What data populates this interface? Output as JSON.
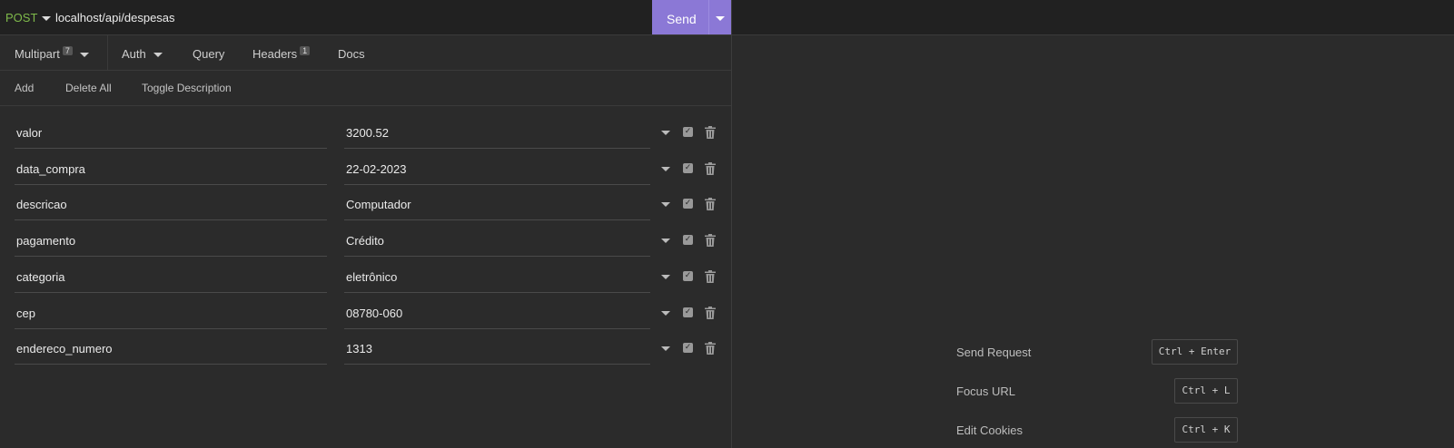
{
  "request": {
    "method": "POST",
    "url": "localhost/api/despesas",
    "send_label": "Send"
  },
  "tabs": [
    {
      "label": "Multipart",
      "badge": "7"
    },
    {
      "label": "Auth"
    },
    {
      "label": "Query"
    },
    {
      "label": "Headers",
      "badge": "1"
    },
    {
      "label": "Docs"
    }
  ],
  "actions": {
    "add": "Add",
    "delete_all": "Delete All",
    "toggle_description": "Toggle Description"
  },
  "params": [
    {
      "name": "valor",
      "value": "3200.52"
    },
    {
      "name": "data_compra",
      "value": "22-02-2023"
    },
    {
      "name": "descricao",
      "value": "Computador"
    },
    {
      "name": "pagamento",
      "value": "Crédito"
    },
    {
      "name": "categoria",
      "value": "eletrônico"
    },
    {
      "name": "cep",
      "value": "08780-060"
    },
    {
      "name": "endereco_numero",
      "value": "1313"
    }
  ],
  "shortcuts": [
    {
      "label": "Send Request",
      "keys": "Ctrl + Enter"
    },
    {
      "label": "Focus URL",
      "keys": "Ctrl + L"
    },
    {
      "label": "Edit Cookies",
      "keys": "Ctrl + K"
    }
  ],
  "colors": {
    "method": "#7fba4b",
    "send_button": "#8b78d6",
    "background": "#2b2b2b"
  },
  "icons": [
    "method-caret-icon",
    "send-options-icon",
    "tab-caret-icon",
    "param-options-icon",
    "checkbox-icon",
    "trash-icon"
  ]
}
